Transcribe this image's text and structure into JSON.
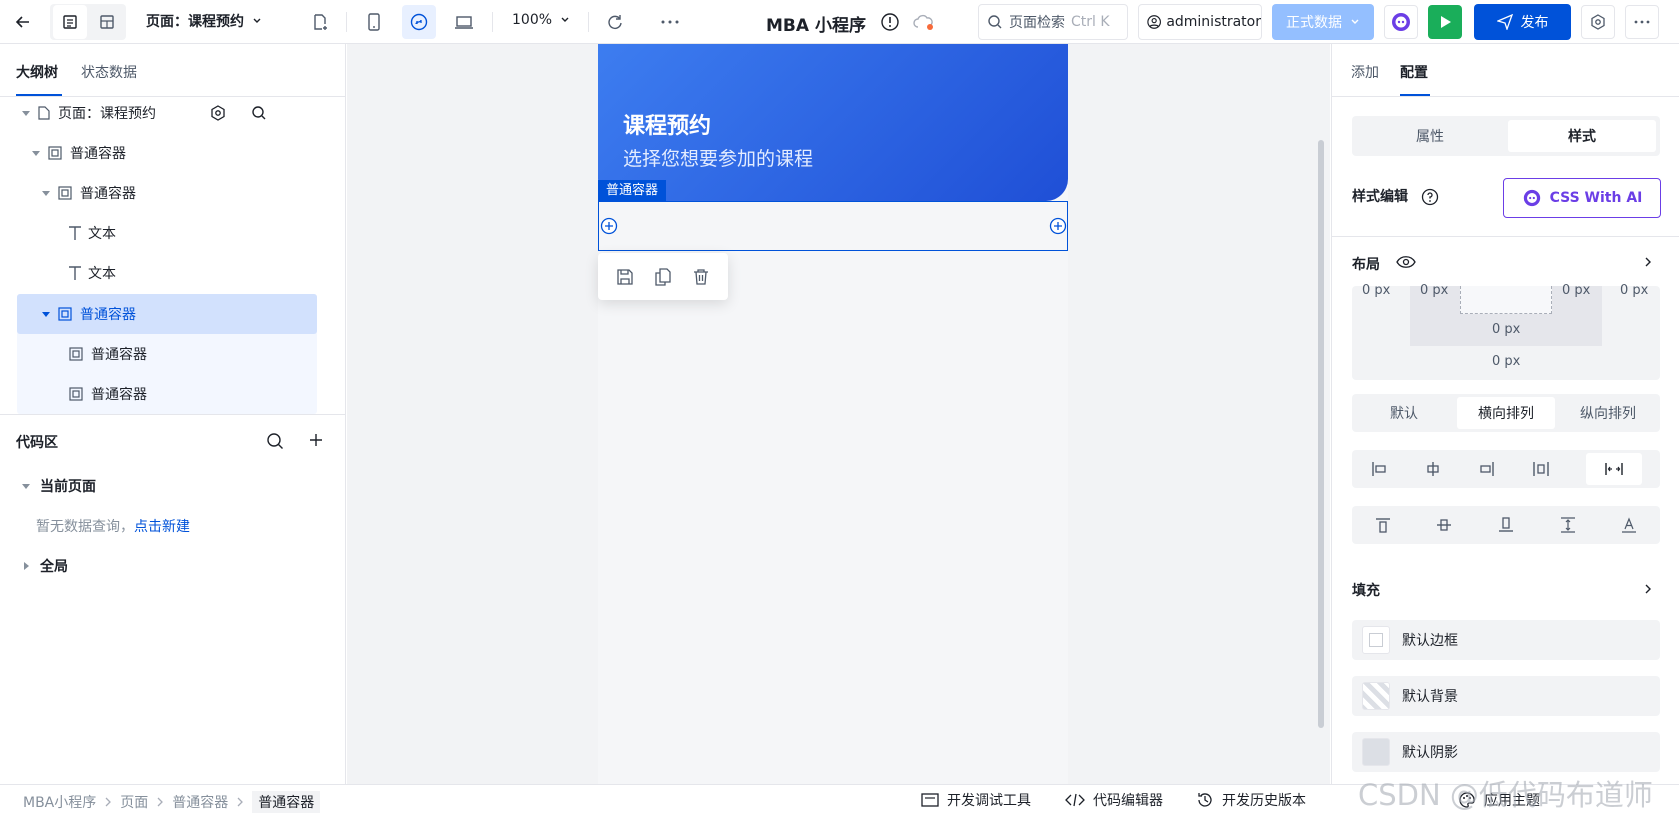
{
  "topbar": {
    "page_label": "页面：课程预约",
    "zoom": "100%",
    "app_title": "MBA 小程序",
    "search_placeholder": "页面检索",
    "search_shortcut": "Ctrl K",
    "user": "administrator",
    "env": "正式数据",
    "publish": "发布"
  },
  "left": {
    "tabs": [
      "大纲树",
      "状态数据"
    ],
    "tree": {
      "page": "页面：课程预约",
      "c1": "普通容器",
      "c2": "普通容器",
      "t1": "文本",
      "t2": "文本",
      "c3": "普通容器",
      "c4": "普通容器",
      "c5": "普通容器"
    },
    "code": {
      "title": "代码区",
      "current": "当前页面",
      "empty": "暂无数据查询，",
      "create": "点击新建",
      "global": "全局"
    }
  },
  "canvas": {
    "banner_title": "课程预约",
    "banner_sub": "选择您想要参加的课程",
    "selected_tag": "普通容器"
  },
  "right": {
    "tabs": [
      "添加",
      "配置"
    ],
    "seg": [
      "属性",
      "样式"
    ],
    "style_edit": "样式编辑",
    "css_ai": "CSS With AI",
    "layout": "布局",
    "px": [
      "0 px",
      "0 px",
      "0 px",
      "0 px",
      "0 px",
      "0 px"
    ],
    "direction": [
      "默认",
      "横向排列",
      "纵向排列"
    ],
    "fill": "填充",
    "fill_items": [
      "默认边框",
      "默认背景",
      "默认阴影"
    ]
  },
  "status": {
    "crumbs": [
      "MBA小程序",
      "页面",
      "普通容器",
      "普通容器"
    ],
    "tools": [
      "开发调试工具",
      "代码编辑器",
      "开发历史版本",
      "应用主题"
    ],
    "watermark": "CSDN @低代码布道师"
  },
  "colors": {
    "primary": "#0052d9",
    "bannerA": "#3d7df0",
    "bannerB": "#1f4fd6",
    "green": "#1aae5a"
  }
}
